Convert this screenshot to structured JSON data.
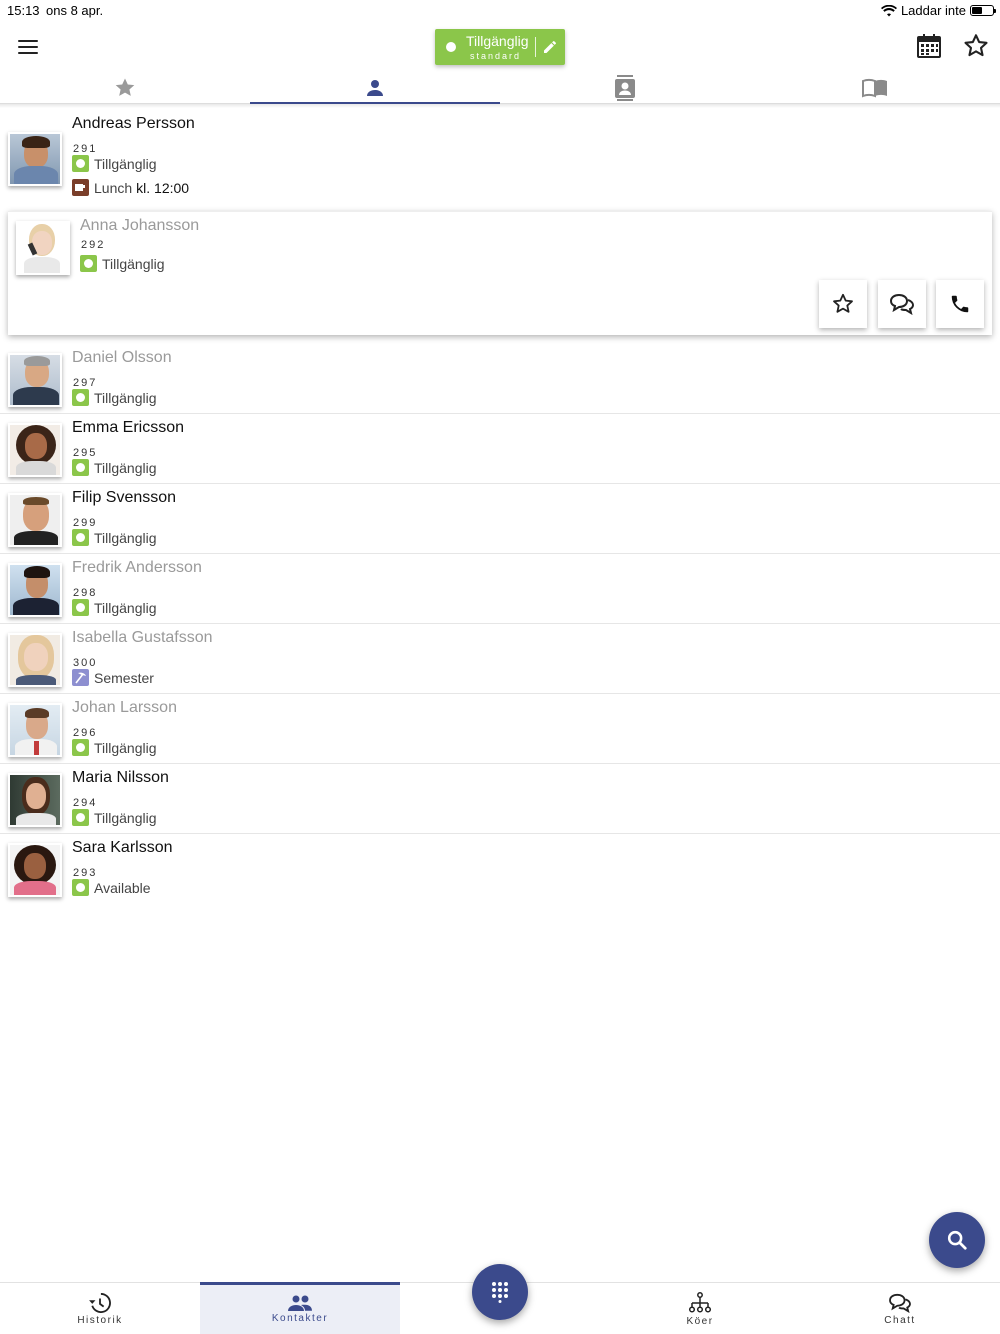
{
  "statusbar": {
    "time": "15:13",
    "date": "ons 8 apr.",
    "charging": "Laddar inte"
  },
  "header": {
    "presence_title": "Tillgänglig",
    "presence_sub": "standard",
    "menu_icon": "hamburger-icon",
    "calendar_icon": "calendar-icon",
    "favorite_icon": "star-outline-icon"
  },
  "tabs": [
    {
      "icon": "star-icon"
    },
    {
      "icon": "person-icon",
      "active": true
    },
    {
      "icon": "contact-card-icon"
    },
    {
      "icon": "book-icon"
    }
  ],
  "colors": {
    "accent": "#3b4a8c",
    "available": "#8bc64a",
    "vacation": "#8d8fd0",
    "lunch": "#7a3e2a"
  },
  "contacts": [
    {
      "name": "Andreas Persson",
      "ext": "291",
      "status": "Tillgänglig",
      "status_type": "available",
      "note_label": "Lunch",
      "note_time": "kl. 12:00",
      "muted": false
    },
    {
      "name": "Anna Johansson",
      "ext": "292",
      "status": "Tillgänglig",
      "status_type": "available",
      "muted": true,
      "expanded": true
    },
    {
      "name": "Daniel  Olsson",
      "ext": "297",
      "status": "Tillgänglig",
      "status_type": "available",
      "muted": true
    },
    {
      "name": "Emma Ericsson",
      "ext": "295",
      "status": "Tillgänglig",
      "status_type": "available",
      "muted": false
    },
    {
      "name": "Filip Svensson",
      "ext": "299",
      "status": "Tillgänglig",
      "status_type": "available",
      "muted": false
    },
    {
      "name": "Fredrik Andersson",
      "ext": "298",
      "status": "Tillgänglig",
      "status_type": "available",
      "muted": true
    },
    {
      "name": "Isabella Gustafsson",
      "ext": "300",
      "status": "Semester",
      "status_type": "vacation",
      "muted": true
    },
    {
      "name": "Johan Larsson",
      "ext": "296",
      "status": "Tillgänglig",
      "status_type": "available",
      "muted": true
    },
    {
      "name": "Maria Nilsson",
      "ext": "294",
      "status": "Tillgänglig",
      "status_type": "available",
      "muted": false
    },
    {
      "name": "Sara  Karlsson",
      "ext": "293",
      "status": "Available",
      "status_type": "available",
      "muted": false
    }
  ],
  "bottomnav": [
    {
      "label": "Historik",
      "icon": "history-icon"
    },
    {
      "label": "Kontakter",
      "icon": "people-icon",
      "active": true
    },
    {
      "label": "",
      "icon": "dialpad-icon"
    },
    {
      "label": "Köer",
      "icon": "queue-tree-icon"
    },
    {
      "label": "Chatt",
      "icon": "chat-icon"
    }
  ]
}
